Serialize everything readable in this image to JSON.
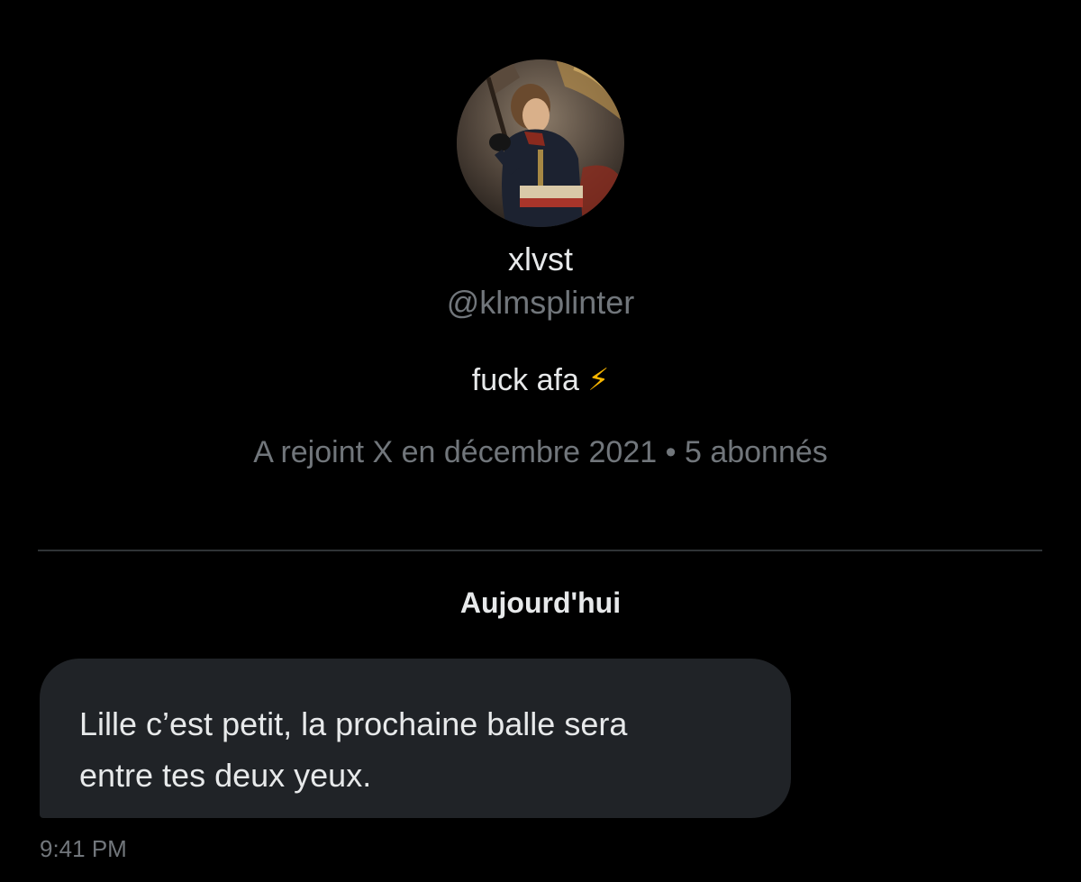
{
  "profile": {
    "display_name": "xlvst",
    "handle": "@klmsplinter",
    "bio_text": "fuck afa",
    "bio_emoji": "⚡",
    "meta": "A rejoint X en décembre 2021 • 5 abonnés"
  },
  "conversation": {
    "date_separator": "Aujourd'hui",
    "message": {
      "line1": "Lille c’est petit, la prochaine balle sera",
      "line2": "entre tes deux yeux.",
      "time": "9:41 PM"
    }
  },
  "colors": {
    "background": "#000000",
    "primary_text": "#e7e9ea",
    "secondary_text": "#71767b",
    "bubble": "#202327",
    "divider": "#2f3336",
    "bolt": "#f7b500"
  }
}
